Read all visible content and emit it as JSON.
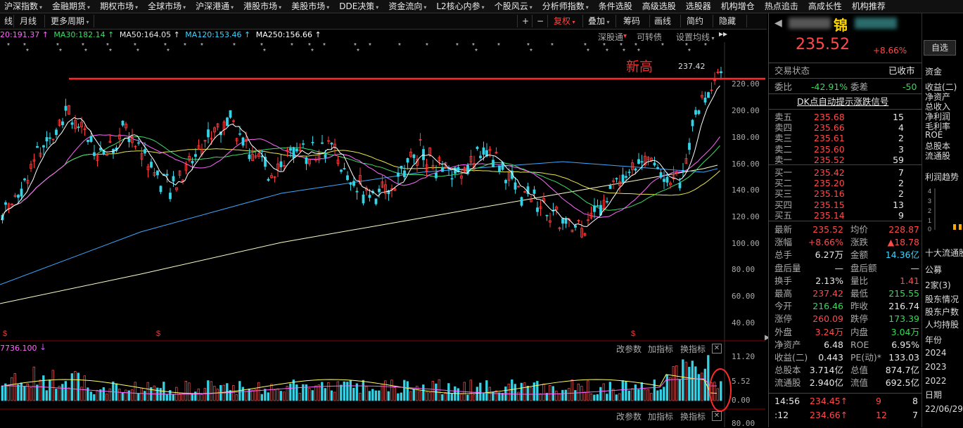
{
  "menu": [
    "沪深指数",
    "金融期货",
    "期权市场",
    "全球市场",
    "沪深港通",
    "港股市场",
    "美股市场",
    "DDE决策",
    "资金流向",
    "L2核心内参",
    "个股风云",
    "分析师指数",
    "条件选股",
    "高级选股",
    "选股器",
    "机构增仓",
    "热点追击",
    "高成长性",
    "机构推荐"
  ],
  "toolbar": {
    "period_left": "线",
    "monthly": "月线",
    "more_period": "更多周期",
    "plus": "+",
    "minus": "−",
    "fuquan": "复权",
    "overlay": "叠加",
    "chips": "筹码",
    "drawline": "画线",
    "simple": "简约",
    "hide": "隐藏"
  },
  "ma": {
    "ma20": "20:191.37",
    "ma30": "MA30:182.14",
    "ma50": "MA50:164.05",
    "ma120": "MA120:153.46",
    "ma250": "MA250:156.66"
  },
  "chart_links": {
    "shen": "深股通",
    "convert": "可转债",
    "setline": "设置均线"
  },
  "annotation": {
    "new_high": "新高",
    "high_price": "237.42"
  },
  "price_axis": [
    "220.00",
    "200.00",
    "180.00",
    "160.00",
    "140.00",
    "120.00",
    "100.00",
    "80.00",
    "60.00",
    "40.00"
  ],
  "vol_axis": [
    "11.20",
    "5.52",
    "0.00"
  ],
  "lower_axis": [
    "80.00"
  ],
  "volume_title": "7736.100",
  "vol_links": {
    "change": "改参数",
    "add": "加指标",
    "switch": "换指标"
  },
  "quote": {
    "name": "锦",
    "price": "235.52",
    "change_pct": "+8.66%",
    "status_label": "交易状态",
    "status_value": "已收市",
    "ratio_label": "委比",
    "ratio_value": "-42.91%",
    "diff_label": "委差",
    "diff_value": "-50",
    "dk_signal": "DK点自动提示涨跌信号",
    "asks": [
      {
        "label": "卖五",
        "price": "235.68",
        "vol": "15"
      },
      {
        "label": "卖四",
        "price": "235.66",
        "vol": "4"
      },
      {
        "label": "卖三",
        "price": "235.61",
        "vol": "2"
      },
      {
        "label": "卖二",
        "price": "235.60",
        "vol": "3"
      },
      {
        "label": "卖一",
        "price": "235.52",
        "vol": "59"
      }
    ],
    "bids": [
      {
        "label": "买一",
        "price": "235.42",
        "vol": "7"
      },
      {
        "label": "买二",
        "price": "235.20",
        "vol": "2"
      },
      {
        "label": "买三",
        "price": "235.16",
        "vol": "2"
      },
      {
        "label": "买四",
        "price": "235.15",
        "vol": "13"
      },
      {
        "label": "买五",
        "price": "235.14",
        "vol": "9"
      }
    ],
    "stats": [
      {
        "l1": "最新",
        "v1": "235.52",
        "c1": "up",
        "l2": "均价",
        "v2": "228.87",
        "c2": "up"
      },
      {
        "l1": "涨幅",
        "v1": "+8.66%",
        "c1": "up",
        "l2": "涨跌",
        "v2": "▲18.78",
        "c2": "up"
      },
      {
        "l1": "总手",
        "v1": "6.27万",
        "c1": "wh",
        "l2": "金额",
        "v2": "14.36亿",
        "c2": "cy"
      },
      {
        "l1": "盘后量",
        "v1": "—",
        "c1": "wh",
        "l2": "盘后额",
        "v2": "—",
        "c2": "wh"
      },
      {
        "l1": "换手",
        "v1": "2.13%",
        "c1": "wh",
        "l2": "量比",
        "v2": "1.41",
        "c2": "up"
      },
      {
        "l1": "最高",
        "v1": "237.42",
        "c1": "up",
        "l2": "最低",
        "v2": "215.55",
        "c2": "dn"
      },
      {
        "l1": "今开",
        "v1": "216.46",
        "c1": "dn",
        "l2": "昨收",
        "v2": "216.74",
        "c2": "wh"
      },
      {
        "l1": "涨停",
        "v1": "260.09",
        "c1": "up",
        "l2": "跌停",
        "v2": "173.39",
        "c2": "dn"
      },
      {
        "l1": "外盘",
        "v1": "3.24万",
        "c1": "up",
        "l2": "内盘",
        "v2": "3.04万",
        "c2": "dn"
      },
      {
        "l1": "净资产",
        "v1": "6.48",
        "c1": "wh",
        "l2": "ROE",
        "v2": "6.95%",
        "c2": "wh"
      },
      {
        "l1": "收益(二)",
        "v1": "0.443",
        "c1": "wh",
        "l2": "PE(动)*",
        "v2": "133.03",
        "c2": "wh"
      },
      {
        "l1": "总股本",
        "v1": "3.714亿",
        "c1": "wh",
        "l2": "总值",
        "v2": "874.7亿",
        "c2": "wh"
      },
      {
        "l1": "流通股",
        "v1": "2.940亿",
        "c1": "wh",
        "l2": "流值",
        "v2": "692.5亿",
        "c2": "wh"
      }
    ],
    "ticks": [
      {
        "time": "14:56",
        "price": "234.45↑",
        "vol": "9",
        "n": "8"
      },
      {
        "time": ":12",
        "price": "234.66↑",
        "vol": "12",
        "n": "7"
      }
    ]
  },
  "far": {
    "select": "自选",
    "capital": "资金",
    "items": [
      "收益(二)",
      "净资产",
      "总收入",
      "净利润",
      "毛利率",
      "ROE",
      "总股本",
      "流通股"
    ],
    "trend": "利润趋势",
    "top10": "十大流通股",
    "notice": "公募",
    "holders": "2家(3)",
    "holder_info": "股东情况",
    "holder_count": "股东户数",
    "avg_hold": "人均持股",
    "year": "年份",
    "years": [
      "2024",
      "2023",
      "2022"
    ],
    "date": "日期",
    "dates": [
      "22/06/29"
    ]
  }
}
